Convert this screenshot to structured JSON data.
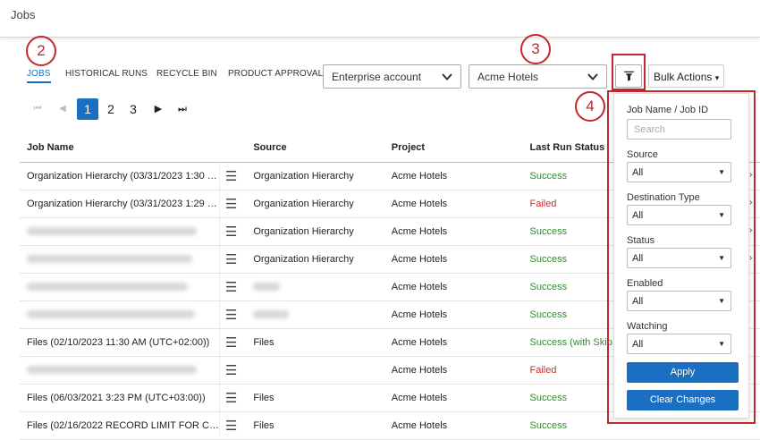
{
  "page_title": "Jobs",
  "tabs": [
    {
      "label": "JOBS",
      "active": true
    },
    {
      "label": "HISTORICAL RUNS",
      "active": false
    },
    {
      "label": "RECYCLE BIN",
      "active": false
    },
    {
      "label": "PRODUCT APPROVAL",
      "active": false
    }
  ],
  "account_select": {
    "value": "Enterprise account"
  },
  "project_select": {
    "value": "Acme Hotels"
  },
  "bulk_actions": {
    "label": "Bulk Actions",
    "caret": "▾"
  },
  "callouts": [
    "2",
    "3",
    "4"
  ],
  "pagination": {
    "first": "⏮",
    "prev": "◀",
    "pages": [
      "1",
      "2",
      "3"
    ],
    "current": "1",
    "next": "▶",
    "last": "⏭"
  },
  "table": {
    "columns": [
      "Job Name",
      "Source",
      "Project",
      "Last Run Status"
    ],
    "rows": [
      {
        "name": "Organization Hierarchy (03/31/2023 1:30 …",
        "source": "Organization Hierarchy",
        "project": "Acme Hotels",
        "status": "Success",
        "status_type": "success"
      },
      {
        "name": "Organization Hierarchy (03/31/2023 1:29 …",
        "source": "Organization Hierarchy",
        "project": "Acme Hotels",
        "status": "Failed",
        "status_type": "failed"
      },
      {
        "name": "",
        "source": "Organization Hierarchy",
        "project": "Acme Hotels",
        "status": "Success",
        "status_type": "success"
      },
      {
        "name": "",
        "source": "Organization Hierarchy",
        "project": "Acme Hotels",
        "status": "Success",
        "status_type": "success"
      },
      {
        "name": "",
        "source": "",
        "project": "Acme Hotels",
        "status": "Success",
        "status_type": "success"
      },
      {
        "name": "",
        "source": "",
        "project": "Acme Hotels",
        "status": "Success",
        "status_type": "success"
      },
      {
        "name": "Files (02/10/2023 11:30 AM (UTC+02:00))",
        "source": "Files",
        "project": "Acme Hotels",
        "status": "Success (with Skip",
        "status_type": "success"
      },
      {
        "name": "",
        "source": "",
        "project": "Acme Hotels",
        "status": "Failed",
        "status_type": "failed"
      },
      {
        "name": "Files (06/03/2021 3:23 PM (UTC+03:00))",
        "source": "Files",
        "project": "Acme Hotels",
        "status": "Success",
        "status_type": "success"
      },
      {
        "name": "Files (02/16/2022 RECORD LIMIT FOR C…",
        "source": "Files",
        "project": "Acme Hotels",
        "status": "Success",
        "status_type": "success"
      }
    ]
  },
  "filter_panel": {
    "job_label": "Job Name / Job ID",
    "search_placeholder": "Search",
    "source_label": "Source",
    "source_value": "All",
    "destination_label": "Destination Type",
    "destination_value": "All",
    "status_label": "Status",
    "status_value": "All",
    "enabled_label": "Enabled",
    "enabled_value": "All",
    "watching_label": "Watching",
    "watching_value": "All",
    "apply_label": "Apply",
    "clear_label": "Clear Changes"
  },
  "colors": {
    "accent": "#1a6fc2",
    "callout": "#c0282d",
    "success": "#2f8c2f",
    "failed": "#d02c2c"
  }
}
